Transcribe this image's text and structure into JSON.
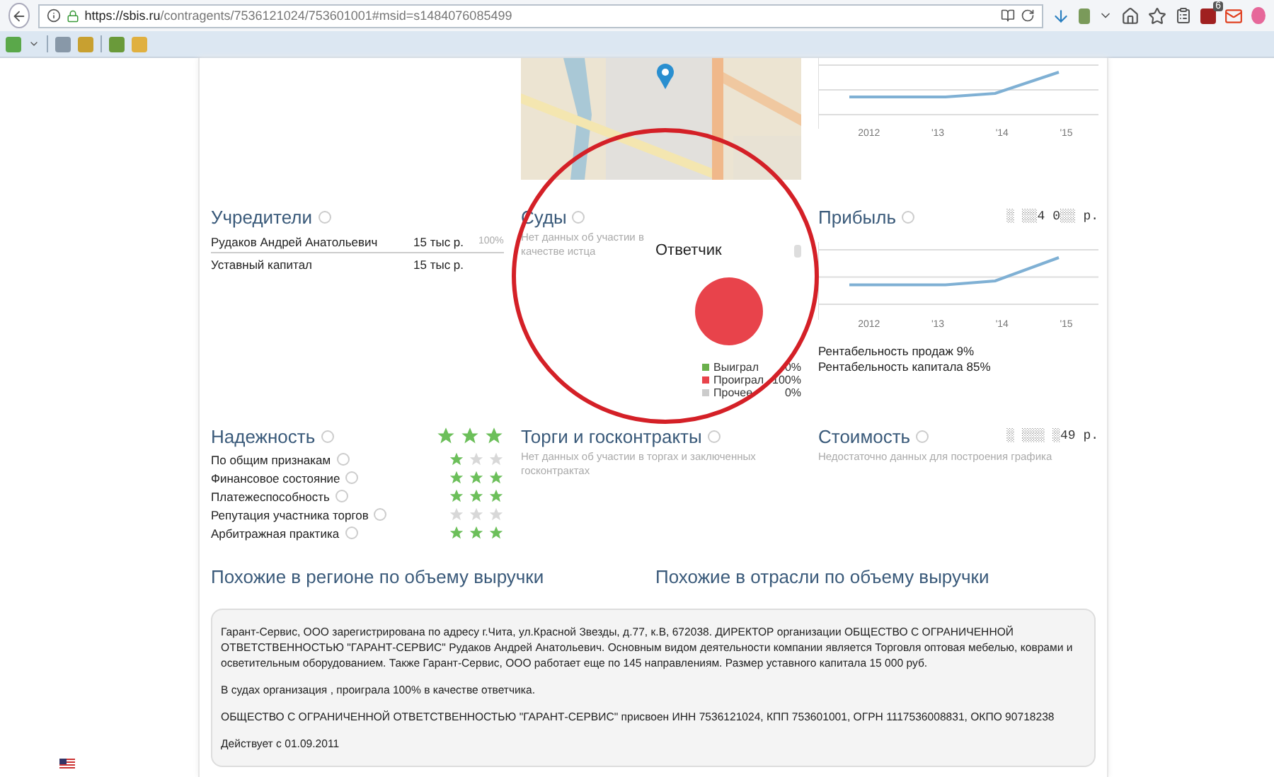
{
  "browser": {
    "url_host": "https://sbis.ru",
    "url_path": "/contragents/7536121024/753601001#msid=s1484076085499",
    "badge": "6"
  },
  "top_chart": {
    "x_labels": [
      "2012",
      "'13",
      "'14",
      "'15"
    ]
  },
  "founders": {
    "title": "Учредители",
    "rows": [
      {
        "name": "Рудаков Андрей Анатольевич",
        "value": "15 тыс р.",
        "share": "100%"
      },
      {
        "name": "Уставный капитал",
        "value": "15 тыс р."
      }
    ]
  },
  "courts": {
    "title": "Суды",
    "note": "Нет данных об участии в качестве истца",
    "defendant": {
      "chart_data": {
        "type": "pie",
        "title": "Ответчик",
        "categories": [
          "Выиграл",
          "Проиграл",
          "Прочее"
        ],
        "series": [
          {
            "values": [
              0,
              100,
              0
            ]
          }
        ]
      },
      "legend": [
        {
          "value": "0%",
          "color": "#6ab04c"
        },
        {
          "value": "100%",
          "color": "#e8434b"
        },
        {
          "value": "0%",
          "color": "#cccccc"
        }
      ]
    }
  },
  "profit": {
    "title": "Прибыль",
    "value": "░ ░░4 0░░ р.",
    "x_labels": [
      "2012",
      "'13",
      "'14",
      "'15"
    ],
    "metrics": [
      "Рентабельность продаж 9%",
      "Рентабельность капитала 85%"
    ]
  },
  "reliability": {
    "title": "Надежность",
    "stars": 3,
    "rows": [
      {
        "label": "По общим признакам",
        "stars": 1
      },
      {
        "label": "Финансовое состояние",
        "stars": 3
      },
      {
        "label": "Платежеспособность",
        "stars": 3
      },
      {
        "label": "Репутация участника торгов",
        "stars": 0
      },
      {
        "label": "Арбитражная практика",
        "stars": 3
      }
    ]
  },
  "tenders": {
    "title": "Торги и госконтракты",
    "note": "Нет данных об участии в торгах и заключенных госконтрактах"
  },
  "cost": {
    "title": "Стоимость",
    "value": "░ ░░░ ░49 р.",
    "note": "Недостаточно данных для построения графика"
  },
  "similar": [
    "Похожие в регионе по объему выручки",
    "Похожие в отрасли по объему выручки"
  ],
  "about": {
    "paragraphs": [
      "Гарант-Сервис, ООО зарегистрирована по адресу г.Чита, ул.Красной Звезды, д.77, к.В, 672038. ДИРЕКТОР организации ОБЩЕСТВО С ОГРАНИЧЕННОЙ ОТВЕТСТВЕННОСТЬЮ \"ГАРАНТ-СЕРВИС\" Рудаков Андрей Анатольевич. Основным видом деятельности компании является Торговля оптовая мебелью, коврами и осветительным оборудованием. Также Гарант-Сервис, ООО работает еще по 145 направлениям. Размер уставного капитала 15 000 руб.",
      "В судах организация , проиграла 100% в качестве ответчика.",
      "ОБЩЕСТВО С ОГРАНИЧЕННОЙ ОТВЕТСТВЕННОСТЬЮ \"ГАРАНТ-СЕРВИС\" присвоен ИНН 7536121024, КПП 753601001, ОГРН 1117536008831, ОКПО 90718238",
      "Действует с 01.09.2011"
    ]
  }
}
